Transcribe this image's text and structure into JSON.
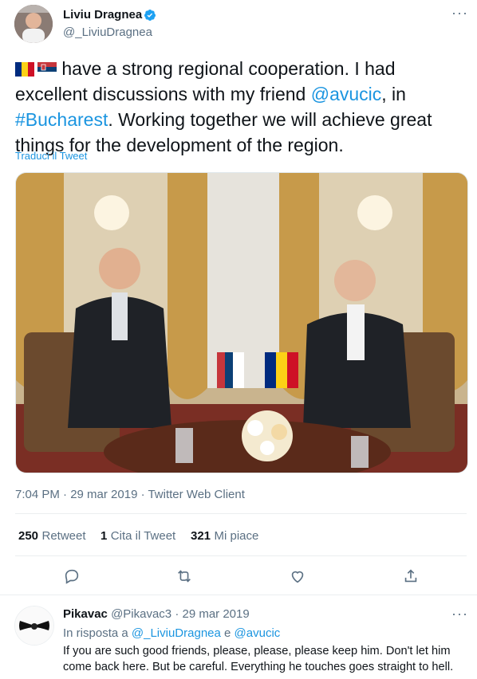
{
  "tweet": {
    "author_name": "Liviu Dragnea",
    "author_handle": "@_LiviuDragnea",
    "verified_icon": "verified-badge-icon",
    "text_parts": {
      "before_mention": " have a strong regional cooperation. I had excellent discussions with my friend ",
      "mention": "@avucic",
      "between": ", in ",
      "hashtag": "#Bucharest",
      "after": ". Working together we will achieve great things for the development of the region."
    },
    "flags": [
      "romania-flag-icon",
      "serbia-flag-icon"
    ],
    "translate_label": "Traduci il Tweet",
    "timestamp": "7:04 PM · 29 mar 2019 · Twitter Web Client",
    "stats": {
      "retweets_count": "250",
      "retweets_label": "Retweet",
      "quotes_count": "1",
      "quotes_label": "Cita il Tweet",
      "likes_count": "321",
      "likes_label": "Mi piace"
    },
    "actions": [
      "reply-icon",
      "retweet-icon",
      "like-icon",
      "share-icon"
    ]
  },
  "reply": {
    "author_name": "Pikavac",
    "author_handle": "@Pikavac3",
    "date": "· 29 mar 2019",
    "in_reply_prefix": "In risposta a",
    "in_reply_user1": "@_LiviuDragnea",
    "in_reply_and": "e",
    "in_reply_user2": "@avucic",
    "text": "If you are such good friends, please, please, please keep him. Don't let him come back here. But be careful. Everything he touches goes straight to hell."
  },
  "colors": {
    "link": "#1b95e0",
    "muted": "#5b7083",
    "text": "#0f1419",
    "divider": "#ebeef0"
  }
}
